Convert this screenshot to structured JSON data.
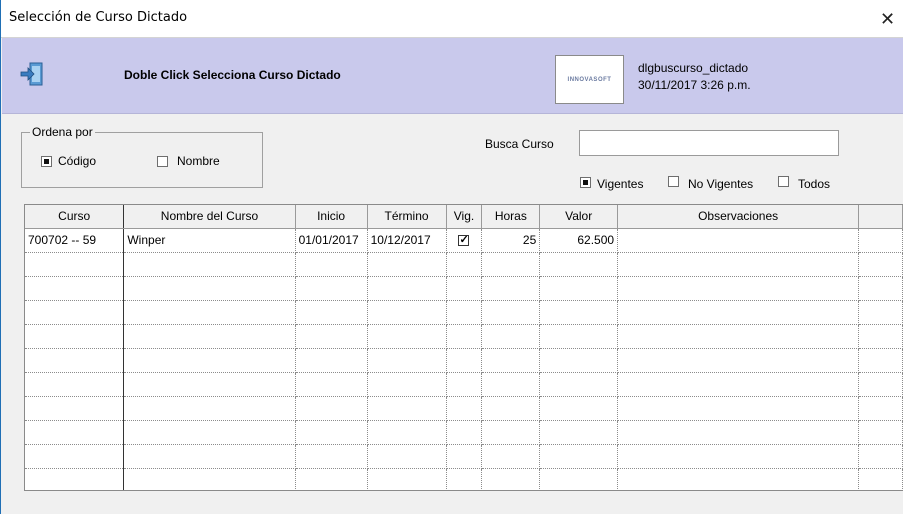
{
  "window": {
    "title": "Selección de Curso Dictado",
    "close_symbol": "✕"
  },
  "header": {
    "icon": "exit-door-icon",
    "message": "Doble Click Selecciona Curso Dictado",
    "logo_text": "INNOVASOFT",
    "dialog_name": "dlgbuscurso_dictado",
    "datetime": "30/11/2017 3:26 p.m."
  },
  "order": {
    "legend": "Ordena por",
    "options": [
      {
        "label": "Código",
        "checked": true
      },
      {
        "label": "Nombre",
        "checked": false
      }
    ]
  },
  "search": {
    "label": "Busca Curso",
    "value": "",
    "placeholder": ""
  },
  "filters": [
    {
      "label": "Vigentes",
      "checked": true
    },
    {
      "label": "No Vigentes",
      "checked": false
    },
    {
      "label": "Todos",
      "checked": false
    }
  ],
  "grid": {
    "columns": [
      "Curso",
      "Nombre del Curso",
      "Inicio",
      "Término",
      "Vig.",
      "Horas",
      "Valor",
      "Observaciones",
      ""
    ],
    "rows": [
      {
        "curso": "700702 -- 59",
        "nombre": "Winper",
        "inicio": "01/01/2017",
        "termino": "10/12/2017",
        "vig": true,
        "horas": "25",
        "valor": "62.500",
        "obs": ""
      }
    ],
    "empty_rows": 10
  },
  "colors": {
    "header_bg": "#c9c9ec",
    "window_bg": "#f0f0f0"
  }
}
